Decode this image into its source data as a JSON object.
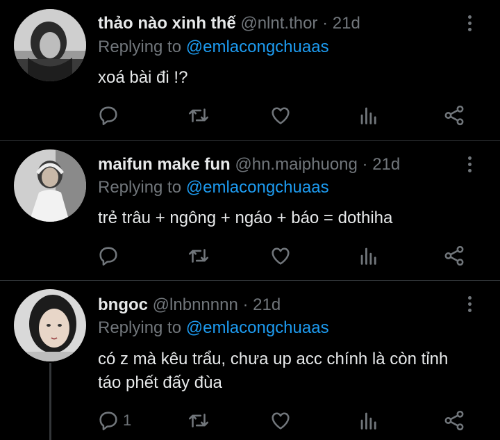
{
  "tweets": [
    {
      "display_name": "thảo nào xinh thế",
      "handle": "@nlnt.thor",
      "time": "21d",
      "replying_prefix": "Replying to",
      "replying_to": "@emlacongchuaas",
      "text": "xoá bài đi !?",
      "reply_count": ""
    },
    {
      "display_name": "maifun make fun",
      "handle": "@hn.maiphuong",
      "time": "21d",
      "replying_prefix": "Replying to",
      "replying_to": "@emlacongchuaas",
      "text": "trẻ trâu + ngông + ngáo + báo = dothiha",
      "reply_count": ""
    },
    {
      "display_name": "bngoc",
      "handle": "@lnbnnnnn",
      "time": "21d",
      "replying_prefix": "Replying to",
      "replying_to": "@emlacongchuaas",
      "text": "có z mà kêu trẩu, chưa up acc chính là còn tỉnh táo phết đấy đùa",
      "reply_count": "1"
    }
  ],
  "separator": " · ",
  "colors": {
    "background": "#000000",
    "text": "#e7e9ea",
    "secondary": "#71767b",
    "accent": "#1d9bf0",
    "divider": "#2f3336"
  },
  "icons": [
    "reply-icon",
    "retweet-icon",
    "like-icon",
    "views-icon",
    "share-icon",
    "more-icon"
  ]
}
